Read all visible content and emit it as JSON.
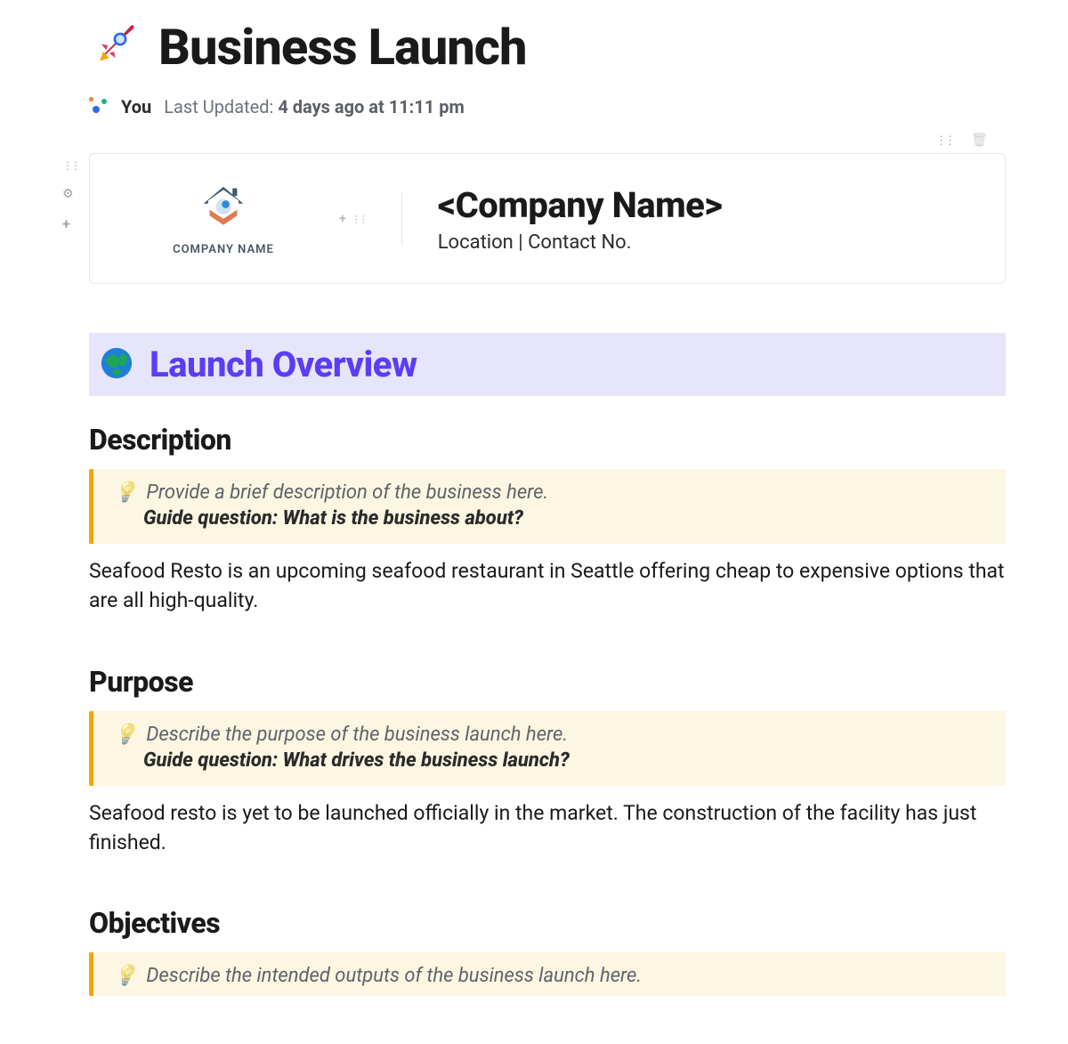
{
  "doc": {
    "title": "Business Launch",
    "author_label": "You",
    "last_updated_prefix": "Last Updated: ",
    "last_updated_value": "4 days ago at 11:11 pm"
  },
  "company_card": {
    "logo_caption": "COMPANY NAME",
    "name_placeholder": "<Company Name>",
    "subline": "Location | Contact No."
  },
  "overview": {
    "banner_title": "Launch Overview",
    "sections": {
      "description": {
        "heading": "Description",
        "hint_line": "Provide a brief description of the business here.",
        "guide_question": "Guide question: What is the business about?",
        "body": "Seafood Resto is an upcoming seafood restaurant in Seattle offering cheap to expensive options that are all high-quality."
      },
      "purpose": {
        "heading": "Purpose",
        "hint_line": "Describe the purpose of the business launch here.",
        "guide_question": "Guide question: What drives the business launch?",
        "body": "Seafood resto is yet to be launched officially in the market. The construction of the facility has just finished."
      },
      "objectives": {
        "heading": "Objectives",
        "hint_line": "Describe the intended outputs of the business launch here."
      }
    }
  }
}
